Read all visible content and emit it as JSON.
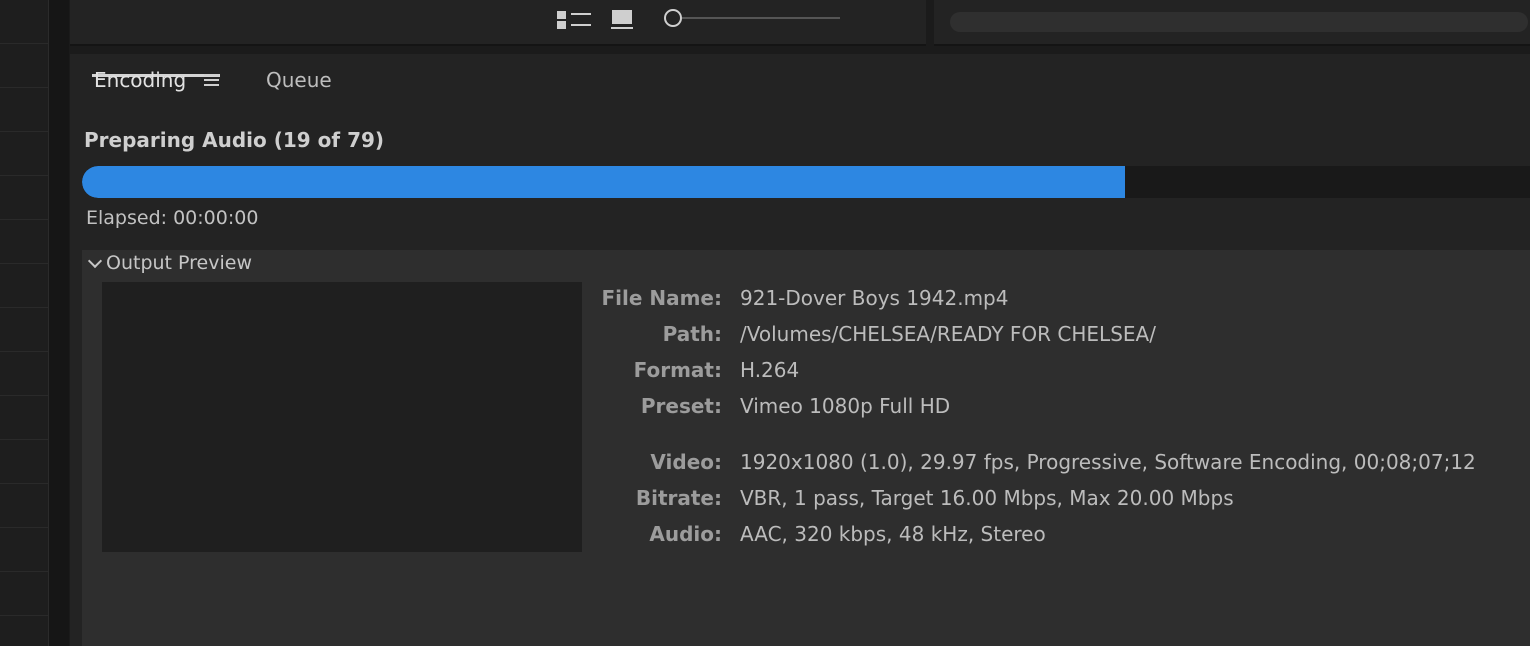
{
  "tabs": {
    "encoding": "Encoding",
    "queue": "Queue"
  },
  "status": {
    "text": "Preparing Audio (19 of 79)",
    "progress_percent": 72,
    "elapsed": "Elapsed: 00:00:00"
  },
  "preview": {
    "header": "Output Preview",
    "details": [
      {
        "label": "File Name:",
        "value": "921-Dover Boys 1942.mp4"
      },
      {
        "label": "Path:",
        "value": "/Volumes/CHELSEA/READY FOR CHELSEA/"
      },
      {
        "label": "Format:",
        "value": "H.264"
      },
      {
        "label": "Preset:",
        "value": "Vimeo 1080p Full HD"
      },
      {
        "label": "Video:",
        "value": "1920x1080 (1.0), 29.97 fps, Progressive, Software Encoding, 00;08;07;12"
      },
      {
        "label": "Bitrate:",
        "value": "VBR, 1 pass, Target 16.00 Mbps, Max 20.00 Mbps"
      },
      {
        "label": "Audio:",
        "value": "AAC, 320 kbps, 48 kHz, Stereo"
      }
    ]
  },
  "icons": {
    "list_view": "list-view-icon",
    "icon_view": "icon-view-icon",
    "zoom": "zoom-slider",
    "menu": "hamburger-menu-icon",
    "collapse": "chevron-down-icon"
  },
  "colors": {
    "accent": "#2d87e2",
    "panel": "#232323",
    "section": "#2e2e2e"
  }
}
